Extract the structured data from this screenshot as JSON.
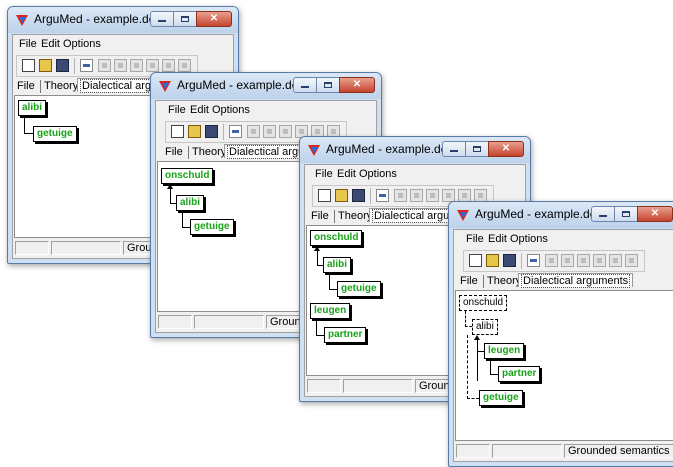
{
  "windows": [
    {
      "title": "ArguMed - example.def",
      "menu": [
        "File",
        "Edit",
        "Options"
      ],
      "tabs": [
        "File",
        "Theory",
        "Dialectical arguments"
      ],
      "nodes": [
        "alibi",
        "getuige"
      ],
      "status": "Grounded semantics mode"
    },
    {
      "title": "ArguMed - example.def",
      "menu": [
        "File",
        "Edit",
        "Options"
      ],
      "tabs": [
        "File",
        "Theory",
        "Dialectical arguments"
      ],
      "nodes": [
        "onschuld",
        "alibi",
        "getuige"
      ],
      "status": "Grounded semantics mode"
    },
    {
      "title": "ArguMed - example.def",
      "menu": [
        "File",
        "Edit",
        "Options"
      ],
      "tabs": [
        "File",
        "Theory",
        "Dialectical arguments"
      ],
      "nodes": [
        "onschuld",
        "alibi",
        "getuige",
        "leugen",
        "partner"
      ],
      "status": "Grounded semantics mode"
    },
    {
      "title": "ArguMed - example.def",
      "menu": [
        "File",
        "Edit",
        "Options"
      ],
      "tabs": [
        "File",
        "Theory",
        "Dialectical arguments"
      ],
      "nodes": [
        "onschuld",
        "alibi",
        "leugen",
        "partner",
        "getuige"
      ],
      "status": "Grounded semantics mode"
    }
  ],
  "colors": {
    "node_text": "#18a418",
    "titlebar": "#cfe0f2",
    "close_button": "#c5442d"
  },
  "icons": [
    "argumed-app-icon",
    "new-file-icon",
    "open-folder-icon",
    "save-disk-icon",
    "argument-tool-icons"
  ]
}
